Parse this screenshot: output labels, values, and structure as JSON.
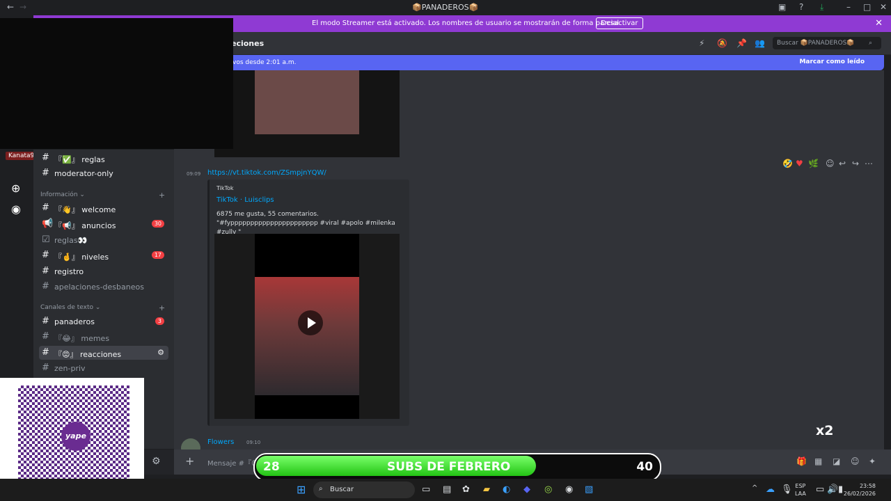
{
  "window": {
    "title": "📦PANADEROS📦"
  },
  "streamer_banner": {
    "message": "El modo Streamer está activado. Los nombres de usuario se mostrarán de forma parcial.",
    "button": "Desactivar"
  },
  "header": {
    "channel_partial": "eciones",
    "search_placeholder": "Buscar 📦PANADEROS📦"
  },
  "new_messages": {
    "text": "vos desde 2:01 a.m.",
    "mark_read": "Marcar como leído"
  },
  "sidebar": {
    "top_items": [
      {
        "name": "reglas",
        "prefix": "『✅』",
        "active": true
      },
      {
        "name": "moderator-only",
        "prefix": "",
        "active": true
      }
    ],
    "category_info": "Información",
    "info_items": [
      {
        "name": "welcome",
        "prefix": "『👋』",
        "active": true,
        "badge": ""
      },
      {
        "name": "anuncios",
        "prefix": "『📢』",
        "active": true,
        "badge": "30"
      },
      {
        "name": "reglas👀",
        "prefix": "",
        "active": false,
        "badge": ""
      },
      {
        "name": "niveles",
        "prefix": "『🤞』",
        "active": true,
        "badge": "17"
      },
      {
        "name": "registro",
        "prefix": "",
        "active": true,
        "badge": ""
      },
      {
        "name": "apelaciones-desbaneos",
        "prefix": "",
        "active": false,
        "badge": ""
      }
    ],
    "category_text": "Canales de texto",
    "text_items": [
      {
        "name": "panaderos",
        "prefix": "",
        "active": true,
        "badge": "3"
      },
      {
        "name": "memes",
        "prefix": "『😂』",
        "active": false,
        "badge": ""
      },
      {
        "name": "reacciones",
        "prefix": "『😡』",
        "active": true,
        "badge": "",
        "selected": true
      },
      {
        "name": "zen-priv",
        "prefix": "",
        "active": false,
        "badge": ""
      }
    ]
  },
  "user_tag": "Kanata9",
  "messages": {
    "timestamp1": "09:09",
    "link": "https://vt.tiktok.com/ZSmpjnYQW/",
    "embed": {
      "provider": "TikTok",
      "title": "TikTok · Luisclips",
      "description": "6875 me gusta, 55 comentarios. \"#fypppppppppppppppppppppp #viral #apolo #milenka #zully \""
    },
    "author": "Flowers",
    "author_time": "09:10"
  },
  "composer": {
    "placeholder": "Mensaje #『😡』reacciones"
  },
  "subs_bar": {
    "current": "28",
    "label": "SUBS DE FEBRERO",
    "goal": "40",
    "progress_fraction": 0.7
  },
  "qr": {
    "logo": "yape"
  },
  "mascot": {
    "text": "x2"
  },
  "taskbar": {
    "search": "Buscar",
    "lang": "ESP",
    "lang2": "LAA",
    "time": "23:58",
    "date": "26/02/2026"
  },
  "colors": {
    "streamer": "#8f3ad3",
    "new_bar": "#5865f2",
    "link": "#00a8fc",
    "badge": "#f23f43",
    "subs_fill": "#23c414"
  }
}
